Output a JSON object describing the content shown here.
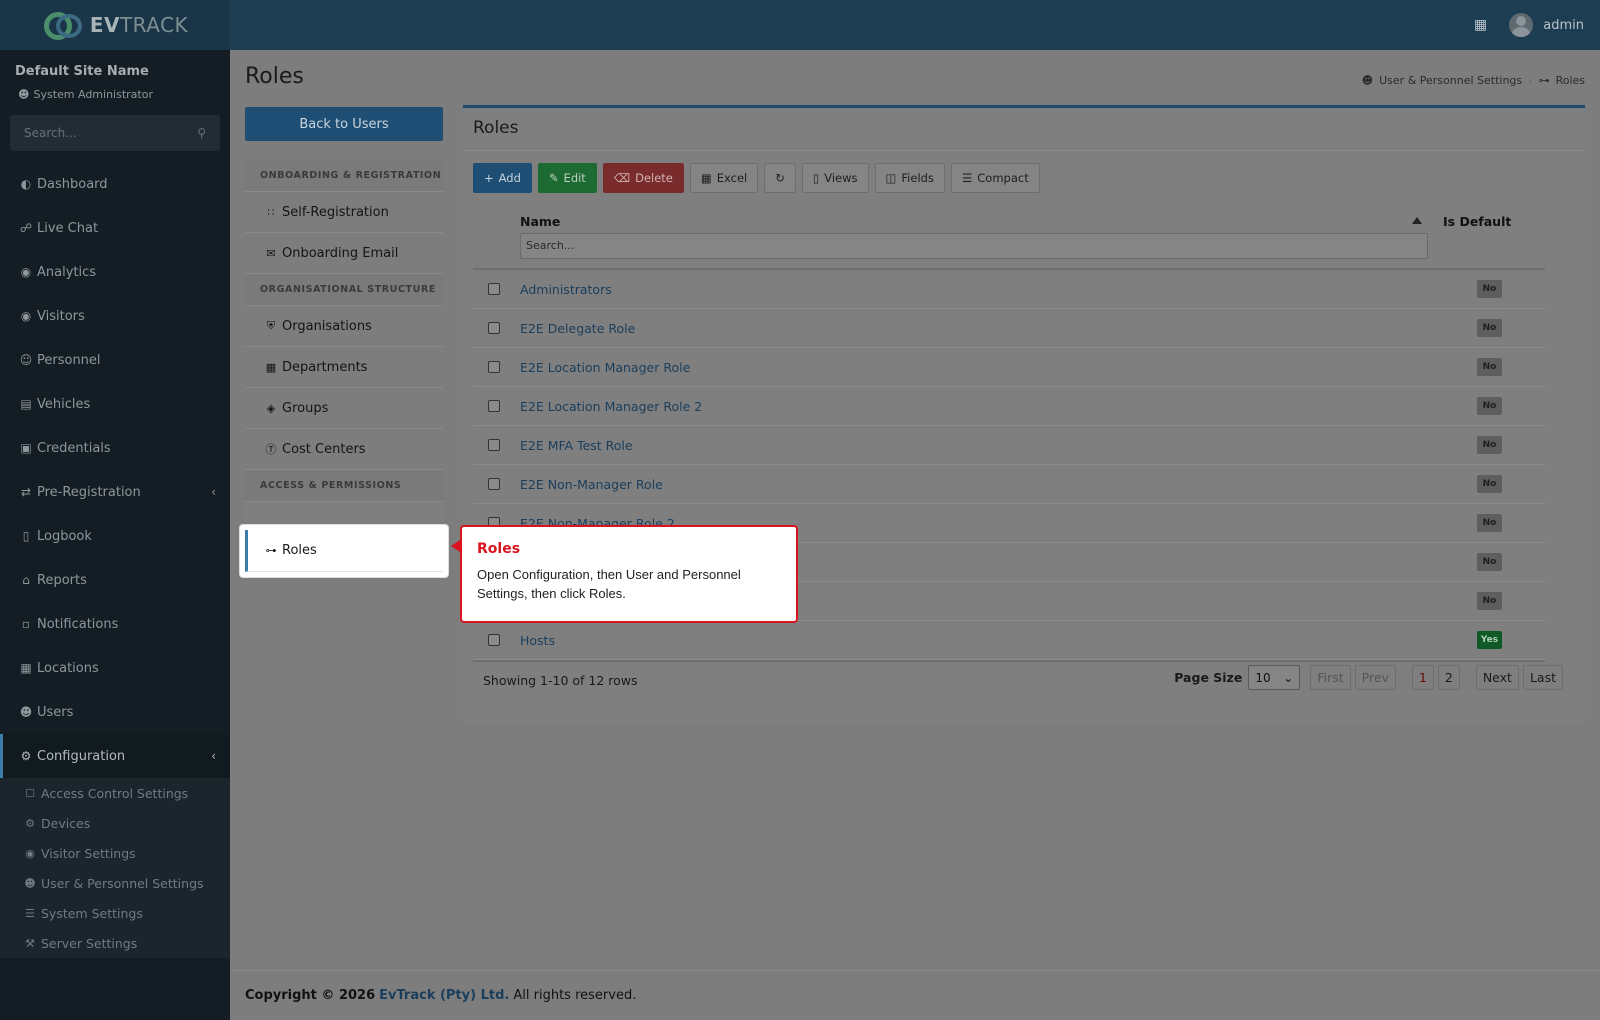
{
  "brand": {
    "logo_text_bold": "EV",
    "logo_text": "TRACK"
  },
  "header": {
    "user_name": "admin"
  },
  "sidebar": {
    "site_name": "Default Site Name",
    "role": "System Administrator",
    "search_placeholder": "Search...",
    "items": [
      {
        "label": "Dashboard",
        "icon": "dashboard-icon"
      },
      {
        "label": "Live Chat",
        "icon": "headset-icon"
      },
      {
        "label": "Analytics",
        "icon": "target-icon"
      },
      {
        "label": "Visitors",
        "icon": "eye-icon"
      },
      {
        "label": "Personnel",
        "icon": "people-icon"
      },
      {
        "label": "Vehicles",
        "icon": "car-icon"
      },
      {
        "label": "Credentials",
        "icon": "id-card-icon"
      },
      {
        "label": "Pre-Registration",
        "icon": "arrows-icon"
      },
      {
        "label": "Logbook",
        "icon": "book-icon"
      },
      {
        "label": "Reports",
        "icon": "chart-icon"
      },
      {
        "label": "Notifications",
        "icon": "chat-icon"
      },
      {
        "label": "Locations",
        "icon": "building-icon"
      },
      {
        "label": "Users",
        "icon": "users-icon"
      },
      {
        "label": "Configuration",
        "icon": "gear-icon"
      }
    ],
    "config_sub": [
      {
        "label": "Access Control Settings",
        "icon": "lock-icon"
      },
      {
        "label": "Devices",
        "icon": "device-icon"
      },
      {
        "label": "Visitor Settings",
        "icon": "eye-icon"
      },
      {
        "label": "User & Personnel Settings",
        "icon": "users-gear-icon"
      },
      {
        "label": "System Settings",
        "icon": "sliders-icon"
      },
      {
        "label": "Server Settings",
        "icon": "wrench-icon"
      }
    ]
  },
  "page": {
    "title": "Roles",
    "breadcrumb": [
      "User & Personnel Settings",
      "Roles"
    ],
    "back_label": "Back to Users"
  },
  "left_panel": {
    "sections": [
      {
        "title": "ONBOARDING & REGISTRATION",
        "items": [
          "Self-Registration",
          "Onboarding Email"
        ]
      },
      {
        "title": "ORGANISATIONAL STRUCTURE",
        "items": [
          "Organisations",
          "Departments",
          "Groups",
          "Cost Centers"
        ]
      },
      {
        "title": "ACCESS & PERMISSIONS",
        "items": [
          "Roles"
        ]
      }
    ]
  },
  "tooltip": {
    "title": "Roles",
    "text": "Open Configuration, then User and Personnel Settings, then click Roles."
  },
  "card": {
    "title": "Roles",
    "toolbar": {
      "add": "Add",
      "edit": "Edit",
      "delete": "Delete",
      "excel": "Excel",
      "views": "Views",
      "fields": "Fields",
      "compact": "Compact"
    },
    "columns": {
      "name": "Name",
      "is_default": "Is Default"
    },
    "search_placeholder": "Search...",
    "rows": [
      {
        "name": "Administrators",
        "default": "No"
      },
      {
        "name": "E2E Delegate Role",
        "default": "No"
      },
      {
        "name": "E2E Location Manager Role",
        "default": "No"
      },
      {
        "name": "E2E Location Manager Role 2",
        "default": "No"
      },
      {
        "name": "E2E MFA Test Role",
        "default": "No"
      },
      {
        "name": "E2E Non-Manager Role",
        "default": "No"
      },
      {
        "name": "E2E Non-Manager Role 2",
        "default": "No"
      },
      {
        "name": "",
        "default": "No"
      },
      {
        "name": "",
        "default": "No"
      },
      {
        "name": "Hosts",
        "default": "Yes"
      }
    ],
    "pager": {
      "info": "Showing 1-10 of 12 rows",
      "page_size_label": "Page Size",
      "page_size": "10",
      "first": "First",
      "prev": "Prev",
      "page1": "1",
      "page2": "2",
      "next": "Next",
      "last": "Last"
    }
  },
  "footer": {
    "copyright": "Copyright © 2026",
    "company": "EvTrack (Pty) Ltd.",
    "rights": "All rights reserved."
  }
}
